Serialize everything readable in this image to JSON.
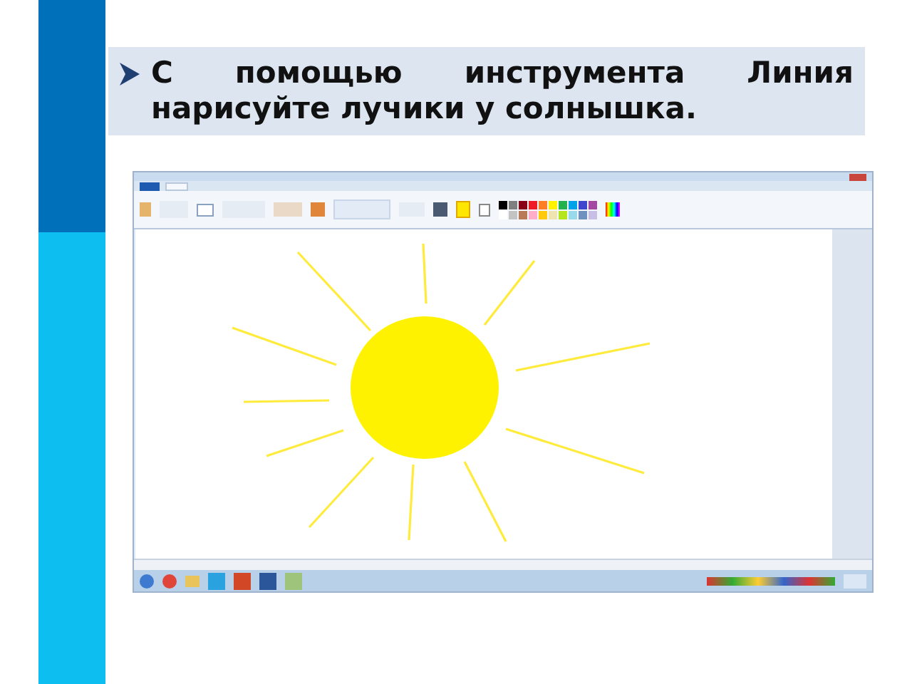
{
  "slide": {
    "bullets": [
      {
        "text": "С помощью инструмента Линия нарисуйте лучики у солнышка."
      }
    ]
  }
}
